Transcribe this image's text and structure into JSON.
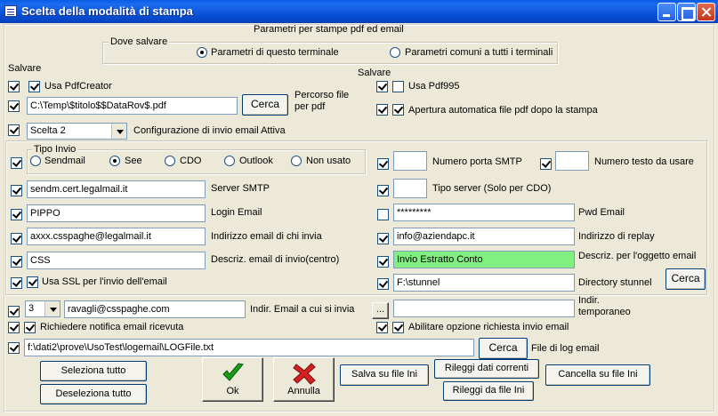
{
  "window": {
    "title": "Scelta della modalità di stampa"
  },
  "header": "Parametri per stampe pdf ed email",
  "dove_salvare": {
    "title": "Dove salvare",
    "opt_terminale": "Parametri di questo terminale",
    "opt_comuni": "Parametri comuni a tutti i terminali"
  },
  "left": {
    "salvare": "Salvare",
    "usa_pdfcreator": "Usa PdfCreator",
    "percorso_value": "C:\\Temp\\$titolo$$DataRov$.pdf",
    "cerca": "Cerca",
    "percorso_label": "Percorso file per pdf",
    "scelta_value": "Scelta 2",
    "configurazione": "Configurazione di invio email Attiva"
  },
  "right_top": {
    "salvare": "Salvare",
    "usa_pdf995": "Usa Pdf995",
    "apertura": "Apertura automatica file pdf dopo la stampa"
  },
  "tipo_invio": {
    "title": "Tipo Invio",
    "options": [
      "Sendmail",
      "See",
      "CDO",
      "Outlook",
      "Non usato"
    ]
  },
  "smtp": {
    "server_value": "sendm.cert.legalmail.it",
    "server_label": "Server SMTP",
    "login_value": "PIPPO",
    "login_label": "Login Email",
    "indirizzo_value": "axxx.csspaghe@legalmail.it",
    "indirizzo_label": "Indirizzo email di chi invia",
    "descr_value": "CSS",
    "descr_label": "Descriz. email di invio(centro)",
    "ssl_label": "Usa SSL per l'invio dell'email",
    "porta_value": "",
    "porta_label": "Numero porta SMTP",
    "numero_testo_value": "",
    "numero_testo_label": "Numero testo da usare",
    "tipo_server_value": "",
    "tipo_server_label": "Tipo server (Solo per CDO)",
    "pwd_value": "*********",
    "pwd_label": "Pwd Email",
    "replay_value": "info@aziendapc.it",
    "replay_label": "Indirizzo di replay",
    "oggetto_value": "Invio Estratto Conto",
    "oggetto_label": "Descriz. per l'oggetto email",
    "stunnel_value": "F:\\stunnel",
    "stunnel_label": "Directory stunnel",
    "cerca": "Cerca"
  },
  "bottom": {
    "num_value": "3",
    "email_value": "ravagli@csspaghe.com",
    "email_label": "Indir. Email a cui si invia",
    "ellipsis": "...",
    "indir_temp_value": "",
    "indir_temp_label": "Indir. temporaneo",
    "richiedere": "Richiedere notifica email ricevuta",
    "abilitare": "Abilitare opzione richiesta invio email",
    "log_value": "f:\\dati2\\prove\\UsoTest\\logemail\\LOGFile.txt",
    "cerca": "Cerca",
    "log_label": "File di log email"
  },
  "buttons": {
    "seleziona": "Seleziona tutto",
    "deseleziona": "Deseleziona tutto",
    "ok": "Ok",
    "annulla": "Annulla",
    "salva": "Salva su file Ini",
    "rileggi_correnti": "Rileggi dati correnti",
    "rileggi_file": "Rileggi da file Ini",
    "cancella": "Cancella su file Ini"
  }
}
